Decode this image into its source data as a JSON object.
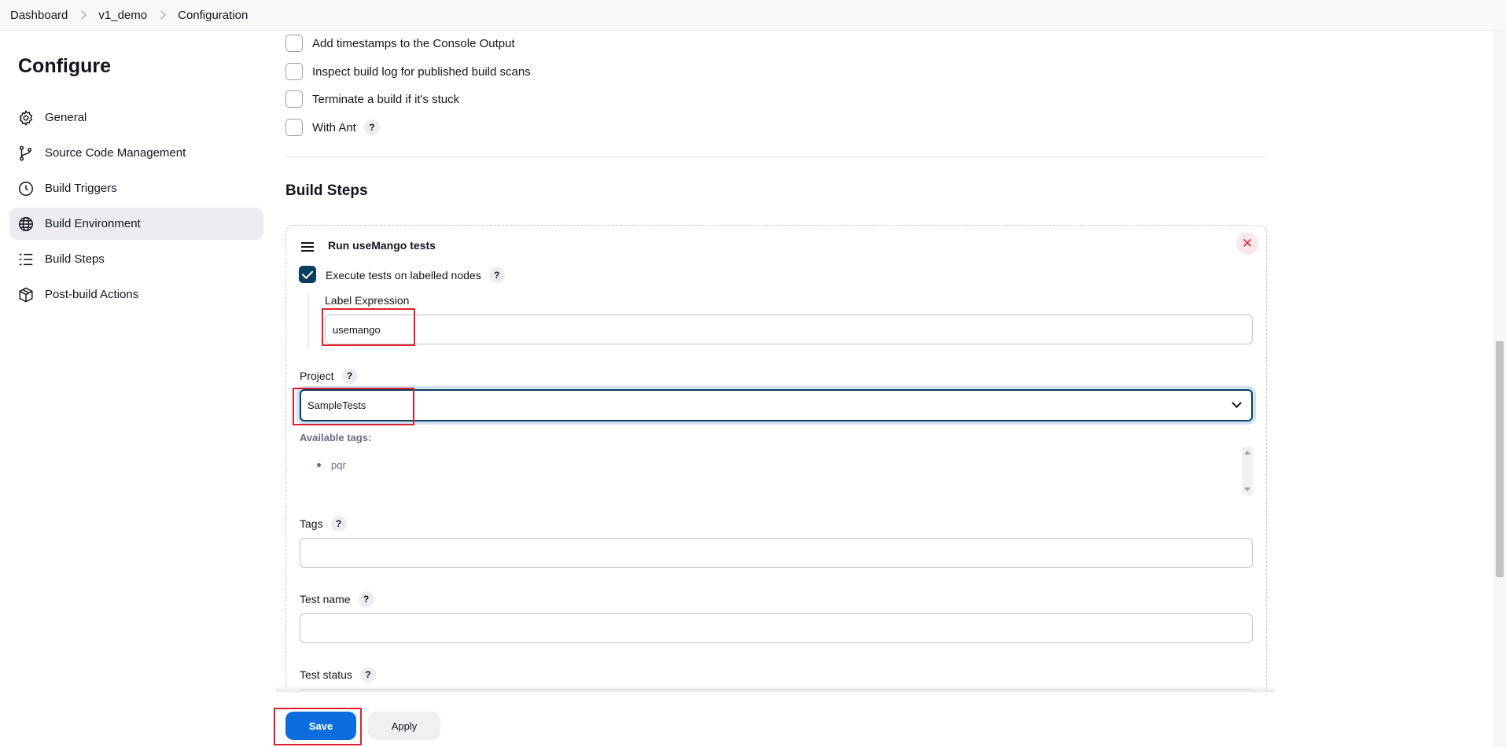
{
  "breadcrumb": [
    "Dashboard",
    "v1_demo",
    "Configuration"
  ],
  "sidebar": {
    "title": "Configure",
    "items": [
      {
        "label": "General",
        "icon": "gear-icon"
      },
      {
        "label": "Source Code Management",
        "icon": "branch-icon"
      },
      {
        "label": "Build Triggers",
        "icon": "clock-icon"
      },
      {
        "label": "Build Environment",
        "icon": "globe-icon",
        "active": true
      },
      {
        "label": "Build Steps",
        "icon": "list-icon"
      },
      {
        "label": "Post-build Actions",
        "icon": "package-icon"
      }
    ]
  },
  "build_environment": {
    "options": [
      {
        "label": "Add timestamps to the Console Output",
        "checked": false
      },
      {
        "label": "Inspect build log for published build scans",
        "checked": false
      },
      {
        "label": "Terminate a build if it's stuck",
        "checked": false
      },
      {
        "label": "With Ant",
        "checked": false,
        "help": "?"
      }
    ]
  },
  "build_steps": {
    "title": "Build Steps",
    "step": {
      "title": "Run useMango tests",
      "close_symbol": "✕",
      "execute_on_nodes": {
        "label": "Execute tests on labelled nodes",
        "checked": true
      },
      "label_expression": {
        "label": "Label Expression",
        "value": "usemango"
      },
      "project": {
        "label": "Project",
        "value": "SampleTests"
      },
      "available_tags": {
        "title": "Available tags:",
        "items": [
          "pqr"
        ]
      },
      "tags": {
        "label": "Tags",
        "value": ""
      },
      "test_name": {
        "label": "Test name",
        "value": ""
      },
      "test_status": {
        "label": "Test status",
        "value": ""
      }
    }
  },
  "help_symbol": "?",
  "actions": {
    "save": "Save",
    "apply": "Apply"
  },
  "colors": {
    "primary": "#0b6edc",
    "checkbox_checked": "#0b3d5c",
    "highlight": "#e0202e",
    "danger": "#e3243b"
  }
}
